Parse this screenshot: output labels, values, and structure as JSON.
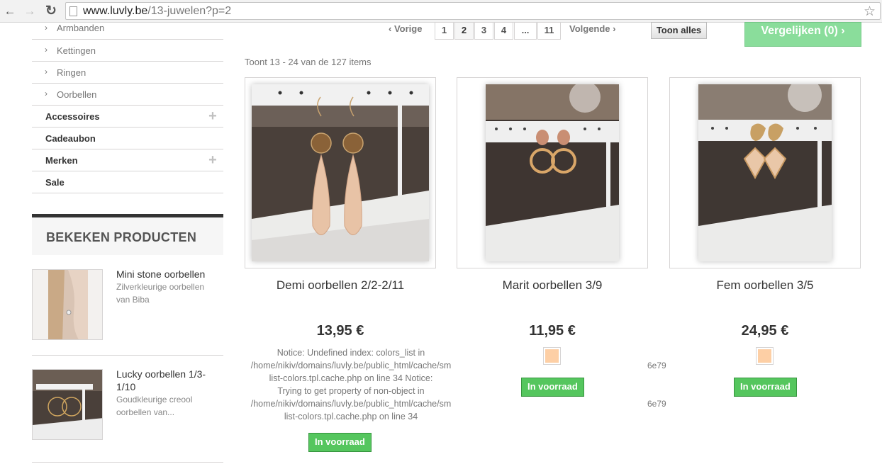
{
  "browser": {
    "url_host": "www.luvly.be",
    "url_path": "/13-juwelen?p=2"
  },
  "sidebar": {
    "subcategories": [
      "Armbanden",
      "Kettingen",
      "Ringen",
      "Oorbellen"
    ],
    "categories": [
      {
        "label": "Accessoires",
        "expandable": true
      },
      {
        "label": "Cadeaubon",
        "expandable": false
      },
      {
        "label": "Merken",
        "expandable": true
      },
      {
        "label": "Sale",
        "expandable": false
      }
    ],
    "viewed_title": "BEKEKEN PRODUCTEN",
    "viewed": [
      {
        "name": "Mini stone oorbellen",
        "desc": "Zilverkleurige oorbellen van Biba"
      },
      {
        "name": "Lucky oorbellen 1/3-1/10",
        "desc": "Goudkleurige creool oorbellen van..."
      }
    ]
  },
  "pagination": {
    "prev_label": "Vorige",
    "next_label": "Volgende",
    "pages": [
      "1",
      "2",
      "3",
      "4",
      "...",
      "11"
    ],
    "current": "2",
    "show_all_label": "Toon alles",
    "compare_label": "Vergelijken (0)"
  },
  "results": {
    "count_text": "Toont 13 - 24 van de 127 items"
  },
  "products": [
    {
      "name": "Demi oorbellen 2/2-2/11",
      "price": "13,95 €",
      "stock": "In voorraad"
    },
    {
      "name": "Marit oorbellen 3/9",
      "price": "11,95 €",
      "stock": "In voorraad",
      "swatch_color": "#fdcfa5"
    },
    {
      "name": "Fem oorbellen 3/5",
      "price": "24,95 €",
      "stock": "In voorraad",
      "swatch_color": "#fdcfa5"
    }
  ],
  "notice": {
    "text": "Notice: Undefined index: colors_list in\n/home/nikiv/domains/luvly.be/public_html/cache/sm\nlist-colors.tpl.cache.php on line 34 Notice:\nTrying to get property of non-object in\n/home/nikiv/domains/luvly.be/public_html/cache/sm\nlist-colors.tpl.cache.php on line 34",
    "fragment": "6e79"
  },
  "colors": {
    "stock_green": "#55c65e",
    "compare_green": "#76d88a",
    "border": "#d6d4d4"
  }
}
